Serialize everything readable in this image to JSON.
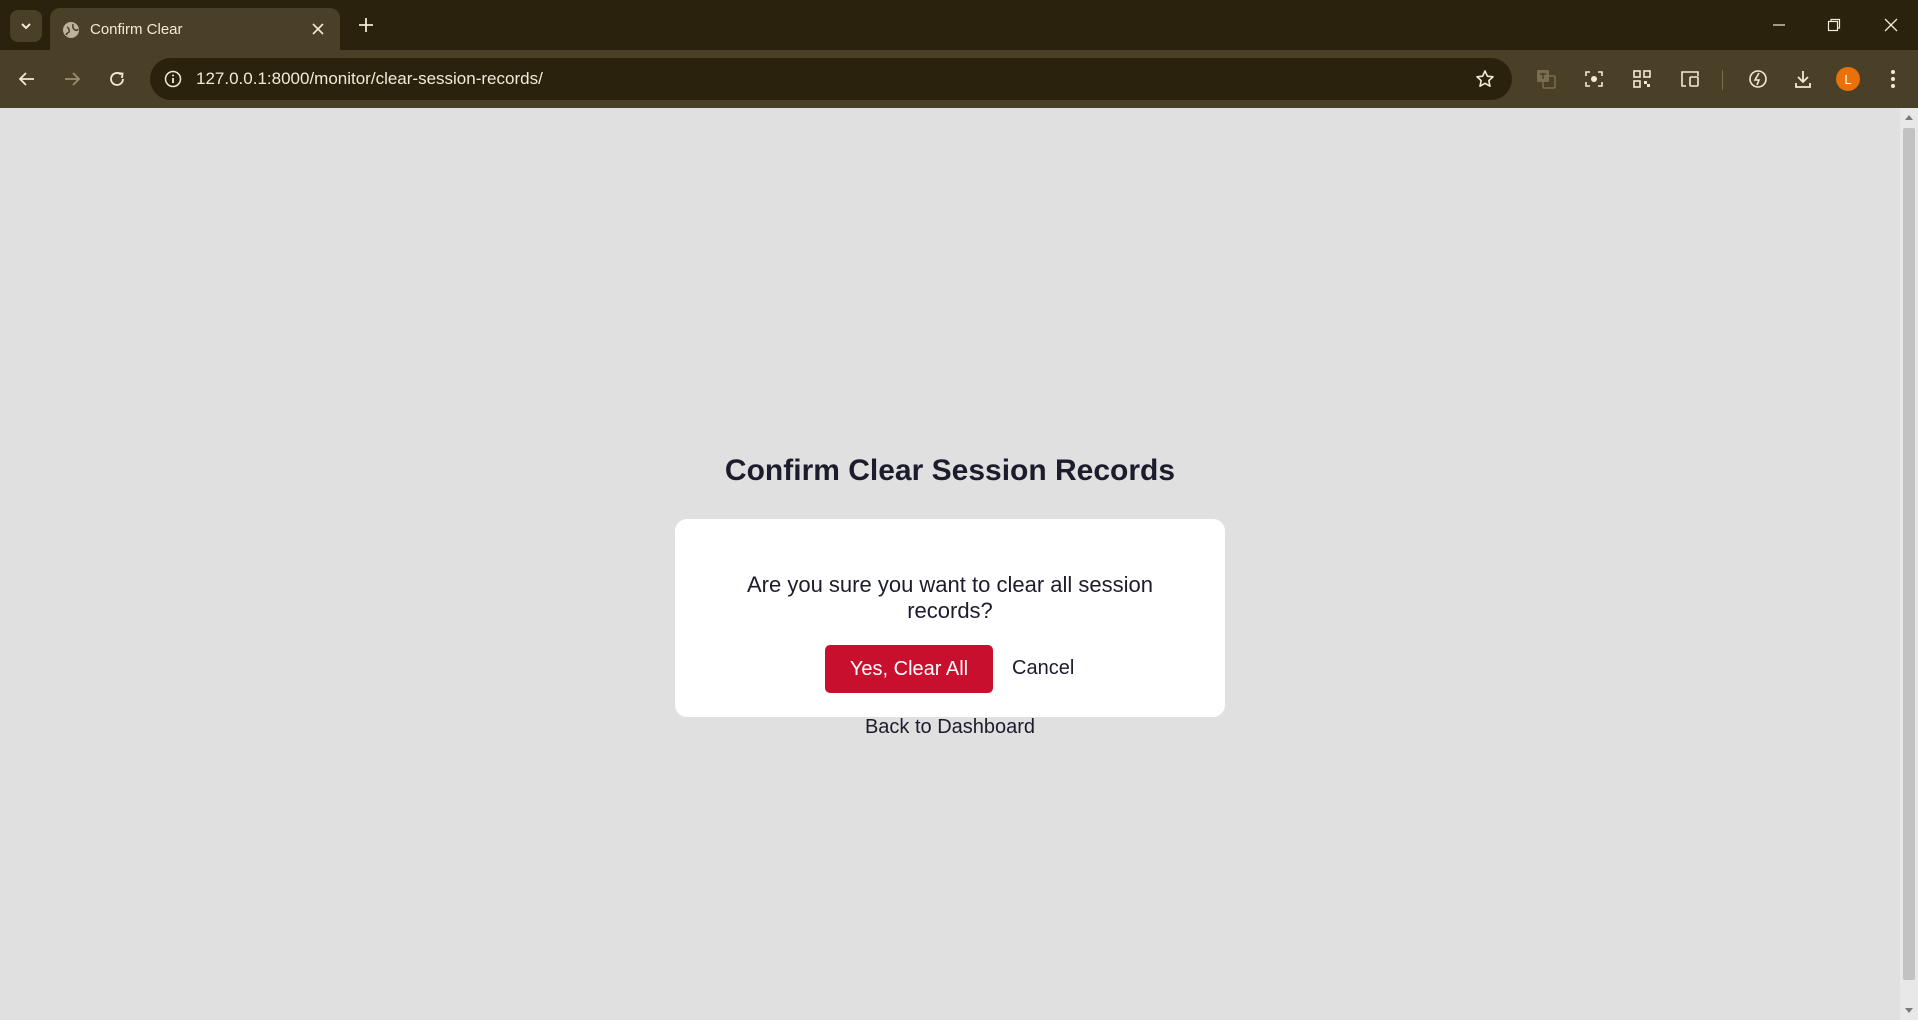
{
  "browser": {
    "tab_title": "Confirm Clear",
    "url": "127.0.0.1:8000/monitor/clear-session-records/",
    "profile_initial": "L",
    "colors": {
      "tabbar_bg": "#2a220d",
      "toolbar_bg": "#4a4028",
      "avatar": "#e8710a"
    }
  },
  "page": {
    "title": "Confirm Clear Session Records",
    "question": "Are you sure you want to clear all session records?",
    "confirm_label": "Yes, Clear All",
    "cancel_label": "Cancel",
    "back_label": "Back to Dashboard",
    "colors": {
      "background": "#e0e0e0",
      "card": "#ffffff",
      "confirm_button": "#c8102e",
      "text": "#1c1c2c"
    }
  },
  "icons": [
    "tab-search-icon",
    "globe-icon",
    "close-icon",
    "plus-icon",
    "minimize-icon",
    "restore-icon",
    "window-close-icon",
    "back-arrow-icon",
    "forward-arrow-icon",
    "reload-icon",
    "info-icon",
    "star-icon",
    "translate-icon",
    "lens-icon",
    "qr-code-icon",
    "cast-icon",
    "performance-icon",
    "download-icon",
    "more-vert-icon"
  ]
}
